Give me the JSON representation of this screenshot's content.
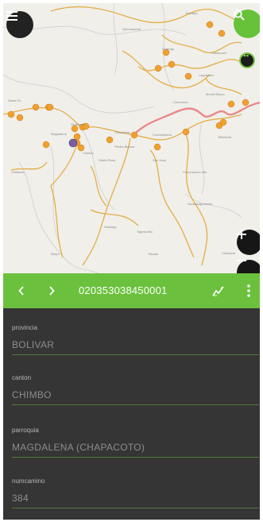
{
  "colors": {
    "accent": "#6bc13d",
    "form_bg": "#353535",
    "road_major": "#e3ae47",
    "road_highlight": "#e98a8a",
    "marker": "#f0a030",
    "marker_selected": "#7a5fa0"
  },
  "map": {
    "labels": [
      "Pucalpa",
      "Guanujo",
      "Laguacoto",
      "Cascaoshi",
      "Santa Fe",
      "Chillanes",
      "Monte Bauco",
      "Churumbo",
      "Guaranda",
      "Chaquisha",
      "Piedra Blanca",
      "Cochabamba",
      "San Juan",
      "Chimbo",
      "Telimbela",
      "Chuchancho Alto",
      "Guacasaguanche",
      "Santiago",
      "Tagma Alto",
      "Ñaqui",
      "Totoras",
      "Chalsana",
      "Magdalena",
      "Quinuacorral",
      "Santa Rosa"
    ]
  },
  "buttons": {
    "menu_icon": "menu-icon",
    "search_icon": "search-icon",
    "chat_icon": "chat-icon",
    "zoom_in_icon": "plus-icon",
    "zoom_out_icon": "minus-icon"
  },
  "toolbar": {
    "prev_icon": "chevron-left-icon",
    "next_icon": "chevron-right-icon",
    "title": "020353038450001",
    "edit_icon": "edit-icon",
    "more_icon": "more-vertical-icon"
  },
  "form": {
    "fields": [
      {
        "label": "provincia",
        "value": "BOLIVAR"
      },
      {
        "label": "canton",
        "value": "CHIMBO"
      },
      {
        "label": "parroquia",
        "value": "MAGDALENA (CHAPACOTO)"
      },
      {
        "label": "numcamino",
        "value": "384"
      }
    ]
  }
}
